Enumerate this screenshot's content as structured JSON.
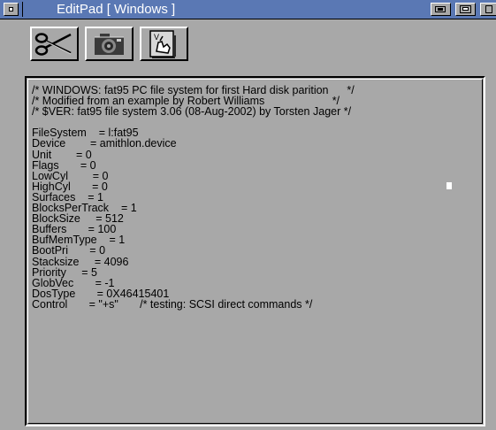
{
  "window": {
    "title": "EditPad [ Windows ]"
  },
  "toolbar": {
    "buttons": [
      {
        "name": "cut",
        "icon": "scissors-icon"
      },
      {
        "name": "tool",
        "icon": "gear-camera-icon"
      },
      {
        "name": "paste",
        "icon": "hand-document-icon"
      }
    ]
  },
  "editor": {
    "lines": [
      "/* WINDOWS: fat95 PC file system for first Hard disk parition      */",
      "/* Modified from an example by Robert Williams                      */",
      "/* $VER: fat95 file system 3.06 (08-Aug-2002) by Torsten Jager */",
      "",
      "FileSystem    = l:fat95",
      "Device        = amithlon.device",
      "Unit        = 0",
      "Flags       = 0",
      "LowCyl        = 0",
      "HighCyl       = 0",
      "Surfaces    = 1",
      "BlocksPerTrack    = 1",
      "BlockSize     = 512",
      "Buffers       = 100",
      "BufMemType    = 1",
      "BootPri       = 0",
      "Stacksize     = 4096",
      "Priority     = 5",
      "GlobVec       = -1",
      "DosType       = 0X46415401",
      "Control       = \"+s\"       /* testing: SCSI direct commands */"
    ]
  },
  "colors": {
    "titlebar": "#5a78b4",
    "window_bg": "#a8a8a8",
    "text": "#000000"
  }
}
